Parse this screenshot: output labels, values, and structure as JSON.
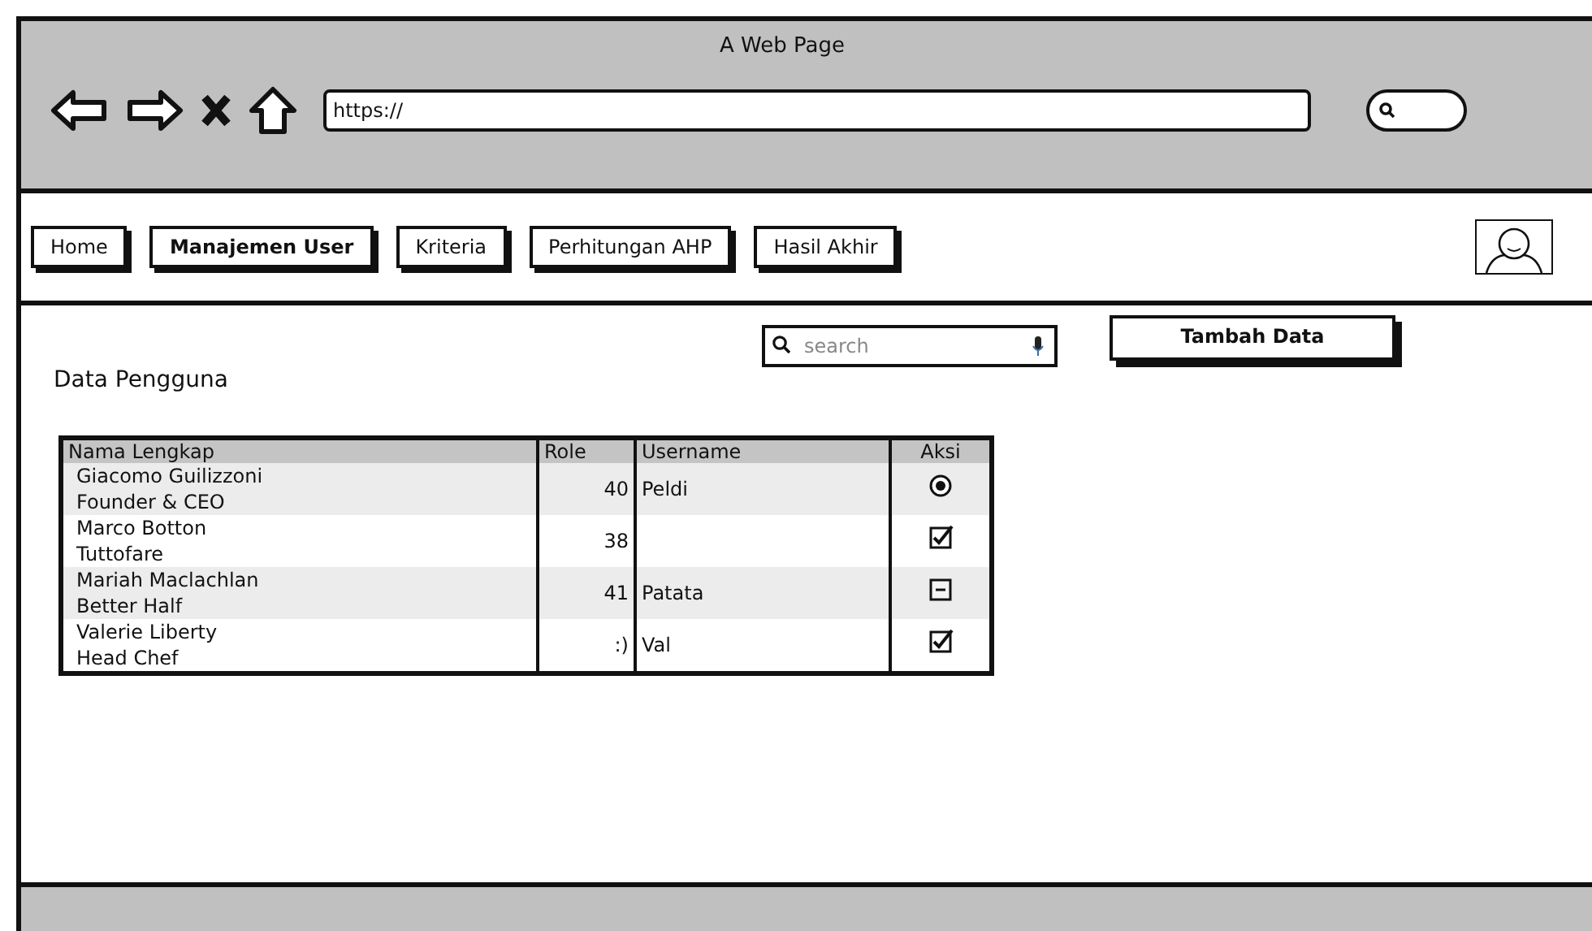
{
  "window": {
    "title": "A Web Page",
    "url": "https://"
  },
  "nav": [
    {
      "label": "Home",
      "selected": false
    },
    {
      "label": "Manajemen User",
      "selected": true
    },
    {
      "label": "Kriteria",
      "selected": false
    },
    {
      "label": "Perhitungan AHP",
      "selected": false
    },
    {
      "label": "Hasil Akhir",
      "selected": false
    }
  ],
  "page_title": "Data Pengguna",
  "search": {
    "placeholder": "search"
  },
  "add_button": "Tambah Data",
  "table": {
    "columns": [
      "Nama Lengkap",
      "Role",
      "Username",
      "Aksi"
    ],
    "rows": [
      {
        "name": "Giacomo Guilizzoni",
        "subtitle": "Founder & CEO",
        "role": "40",
        "username": "Peldi",
        "action": {
          "kind": "radio",
          "checked": true
        }
      },
      {
        "name": "Marco Botton",
        "subtitle": "Tuttofare",
        "role": "38",
        "action": {
          "kind": "checkbox",
          "checked": true,
          "indeterminate": false
        }
      },
      {
        "name": "Mariah Maclachlan",
        "subtitle": "Better Half",
        "role": "41",
        "username": "Patata",
        "action": {
          "kind": "checkbox",
          "checked": false,
          "indeterminate": true
        }
      },
      {
        "name": "Valerie Liberty",
        "subtitle": "Head Chef",
        "role": ":)",
        "username": "Val",
        "action": {
          "kind": "checkbox",
          "checked": true,
          "indeterminate": false
        }
      }
    ]
  }
}
